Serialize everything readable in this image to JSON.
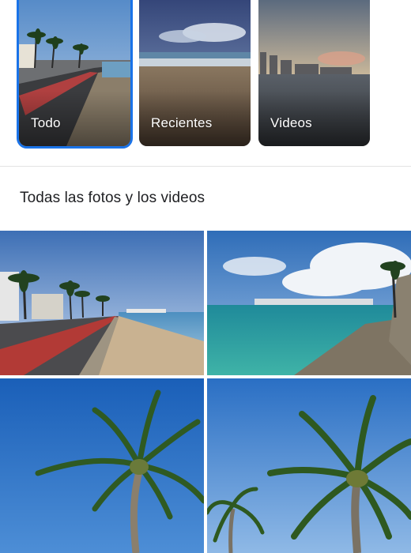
{
  "albums": [
    {
      "label": "Todo",
      "selected": true
    },
    {
      "label": "Recientes",
      "selected": false
    },
    {
      "label": "Videos",
      "selected": false
    }
  ],
  "section": {
    "title": "Todas las fotos y los videos"
  },
  "colors": {
    "accent": "#1a73e8"
  }
}
